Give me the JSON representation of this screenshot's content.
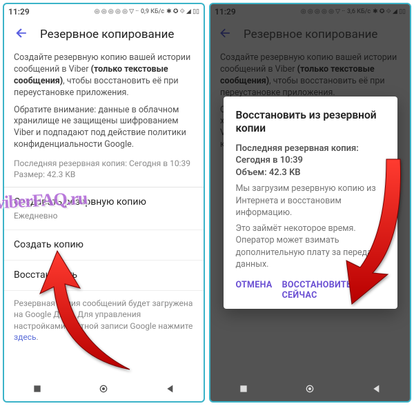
{
  "status": {
    "time": "11:29",
    "data_rate_left": "0,9 КБ/с",
    "data_rate_right": "3,6 КБ/с"
  },
  "appbar": {
    "title": "Резервное копирование"
  },
  "intro": {
    "line1_a": "Создайте резервную копию вашей истории сообщений в Viber ",
    "line1_b": "(только текстовые сообщения)",
    "line1_c": ", чтобы восстановить её при переустановке приложения.",
    "line2": "Обратите внимание: данные в облачном хранилище не защищены шифрованием Viber и подпадают под действие политики конфиденциальности Google."
  },
  "meta": {
    "last_backup": "Последняя резервная копия: Сегодня в 10:39",
    "size": "Размер: 42.3 KB"
  },
  "rows": {
    "create_backup": {
      "title": "Создавать резервную копию",
      "sub": "Ежедневно"
    },
    "make_copy": {
      "title": "Создать копию"
    },
    "restore": {
      "title": "Восстановить"
    }
  },
  "footnote": {
    "text_a": "Резервная копия сообщений будет загружена на Google Диск. Для управления настройками учётной записи Google нажмите ",
    "link": "здесь",
    "text_b": "."
  },
  "dialog": {
    "title": "Восстановить из резервной копии",
    "meta1": "Последняя резервная копия: Сегодня в 10:39",
    "meta2": "Объем: 42.3 KB",
    "body1": "Мы загрузим резервную копию из Интернета и восстановим информацию.",
    "body2": "Это займёт некоторое время. Оператор может взимать дополнительную плату за передачу данных.",
    "cancel": "ОТМЕНА",
    "confirm": "ВОССТАНОВИТЬ СЕЙЧАС"
  },
  "watermark": "viberFAQ.ru"
}
